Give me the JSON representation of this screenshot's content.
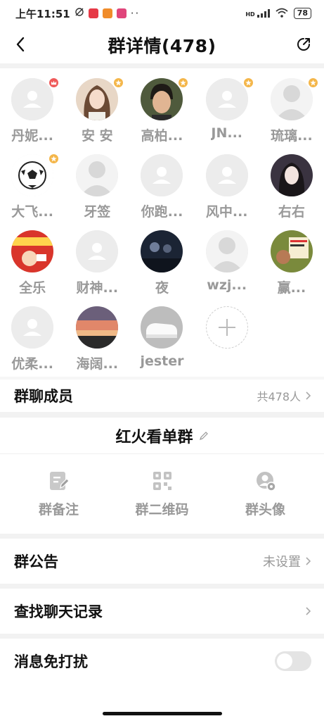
{
  "status": {
    "time": "上午11:51",
    "signal": "HD",
    "battery": "78",
    "more": "··"
  },
  "header": {
    "title": "群详情(478)"
  },
  "members": [
    {
      "name": "丹妮...",
      "badge": "owner",
      "avatar": "default"
    },
    {
      "name": "安 安",
      "badge": "admin",
      "avatar": "photo-girl"
    },
    {
      "name": "高柏...",
      "badge": "admin",
      "avatar": "photo-man"
    },
    {
      "name": "JN...",
      "badge": "admin",
      "avatar": "default"
    },
    {
      "name": "琉璃...",
      "badge": "admin",
      "avatar": "silhouette"
    },
    {
      "name": "大飞...",
      "badge": "admin",
      "avatar": "soccer"
    },
    {
      "name": "牙签",
      "badge": "",
      "avatar": "silhouette"
    },
    {
      "name": "你跑...",
      "badge": "",
      "avatar": "default"
    },
    {
      "name": "风中...",
      "badge": "",
      "avatar": "default"
    },
    {
      "name": "右右",
      "badge": "",
      "avatar": "photo-girl2"
    },
    {
      "name": "全乐",
      "badge": "",
      "avatar": "notice"
    },
    {
      "name": "财神...",
      "badge": "",
      "avatar": "default"
    },
    {
      "name": "夜",
      "badge": "",
      "avatar": "night"
    },
    {
      "name": "wzj...",
      "badge": "",
      "avatar": "silhouette"
    },
    {
      "name": "赢...",
      "badge": "",
      "avatar": "poster"
    },
    {
      "name": "优柔...",
      "badge": "",
      "avatar": "default"
    },
    {
      "name": "海阔...",
      "badge": "",
      "avatar": "sunset"
    },
    {
      "name": "jester",
      "badge": "",
      "avatar": "shoes"
    }
  ],
  "member_row": {
    "label": "群聊成员",
    "count": "共478人"
  },
  "group_name": "红火看单群",
  "actions": [
    {
      "label": "群备注",
      "icon": "note-edit-icon"
    },
    {
      "label": "群二维码",
      "icon": "qrcode-icon"
    },
    {
      "label": "群头像",
      "icon": "group-avatar-icon"
    }
  ],
  "announcement": {
    "label": "群公告",
    "value": "未设置"
  },
  "search_history": {
    "label": "查找聊天记录"
  },
  "mute": {
    "label": "消息免打扰",
    "on": false
  }
}
